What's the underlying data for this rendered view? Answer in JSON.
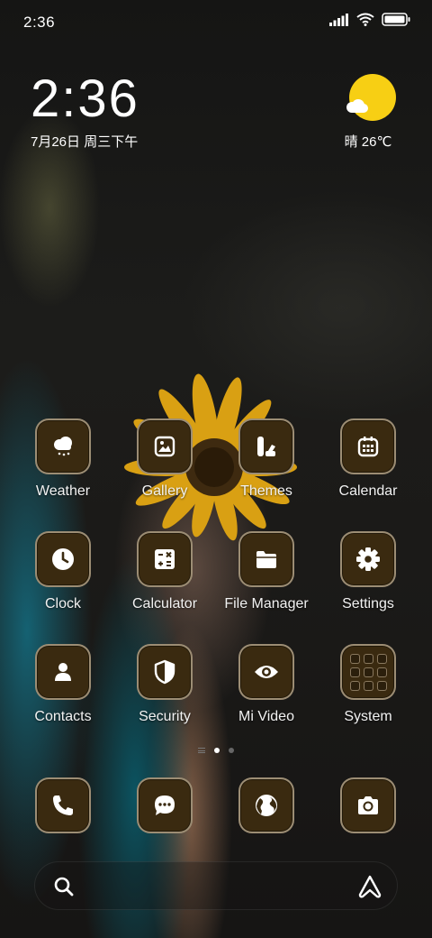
{
  "status_bar": {
    "time": "2:36",
    "icons": [
      "signal-icon",
      "wifi-icon",
      "battery-icon"
    ]
  },
  "clock_widget": {
    "time": "2:36",
    "date": "7月26日 周三下午"
  },
  "weather_widget": {
    "condition_temp": "晴 26℃",
    "icon": "sun-icon",
    "sun_color": "#f7cf14"
  },
  "apps": [
    {
      "label": "Weather",
      "icon": "cloud-rain-icon"
    },
    {
      "label": "Gallery",
      "icon": "image-icon"
    },
    {
      "label": "Themes",
      "icon": "palette-icon"
    },
    {
      "label": "Calendar",
      "icon": "calendar-icon"
    },
    {
      "label": "Clock",
      "icon": "clock-icon"
    },
    {
      "label": "Calculator",
      "icon": "calculator-icon"
    },
    {
      "label": "File Manager",
      "icon": "folder-icon"
    },
    {
      "label": "Settings",
      "icon": "gear-icon"
    },
    {
      "label": "Contacts",
      "icon": "person-icon"
    },
    {
      "label": "Security",
      "icon": "shield-icon"
    },
    {
      "label": "Mi Video",
      "icon": "eye-icon"
    },
    {
      "label": "System",
      "icon": "folder-grid-icon"
    }
  ],
  "page_indicator": {
    "pages": 2,
    "active": 1
  },
  "dock": [
    {
      "icon": "phone-icon"
    },
    {
      "icon": "message-icon"
    },
    {
      "icon": "globe-icon"
    },
    {
      "icon": "camera-icon"
    }
  ],
  "search_bar": {
    "left_icon": "search-icon",
    "right_icon": "assistant-icon"
  },
  "colors": {
    "icon_bg": "#3a2a10",
    "icon_border": "#beaf96"
  }
}
